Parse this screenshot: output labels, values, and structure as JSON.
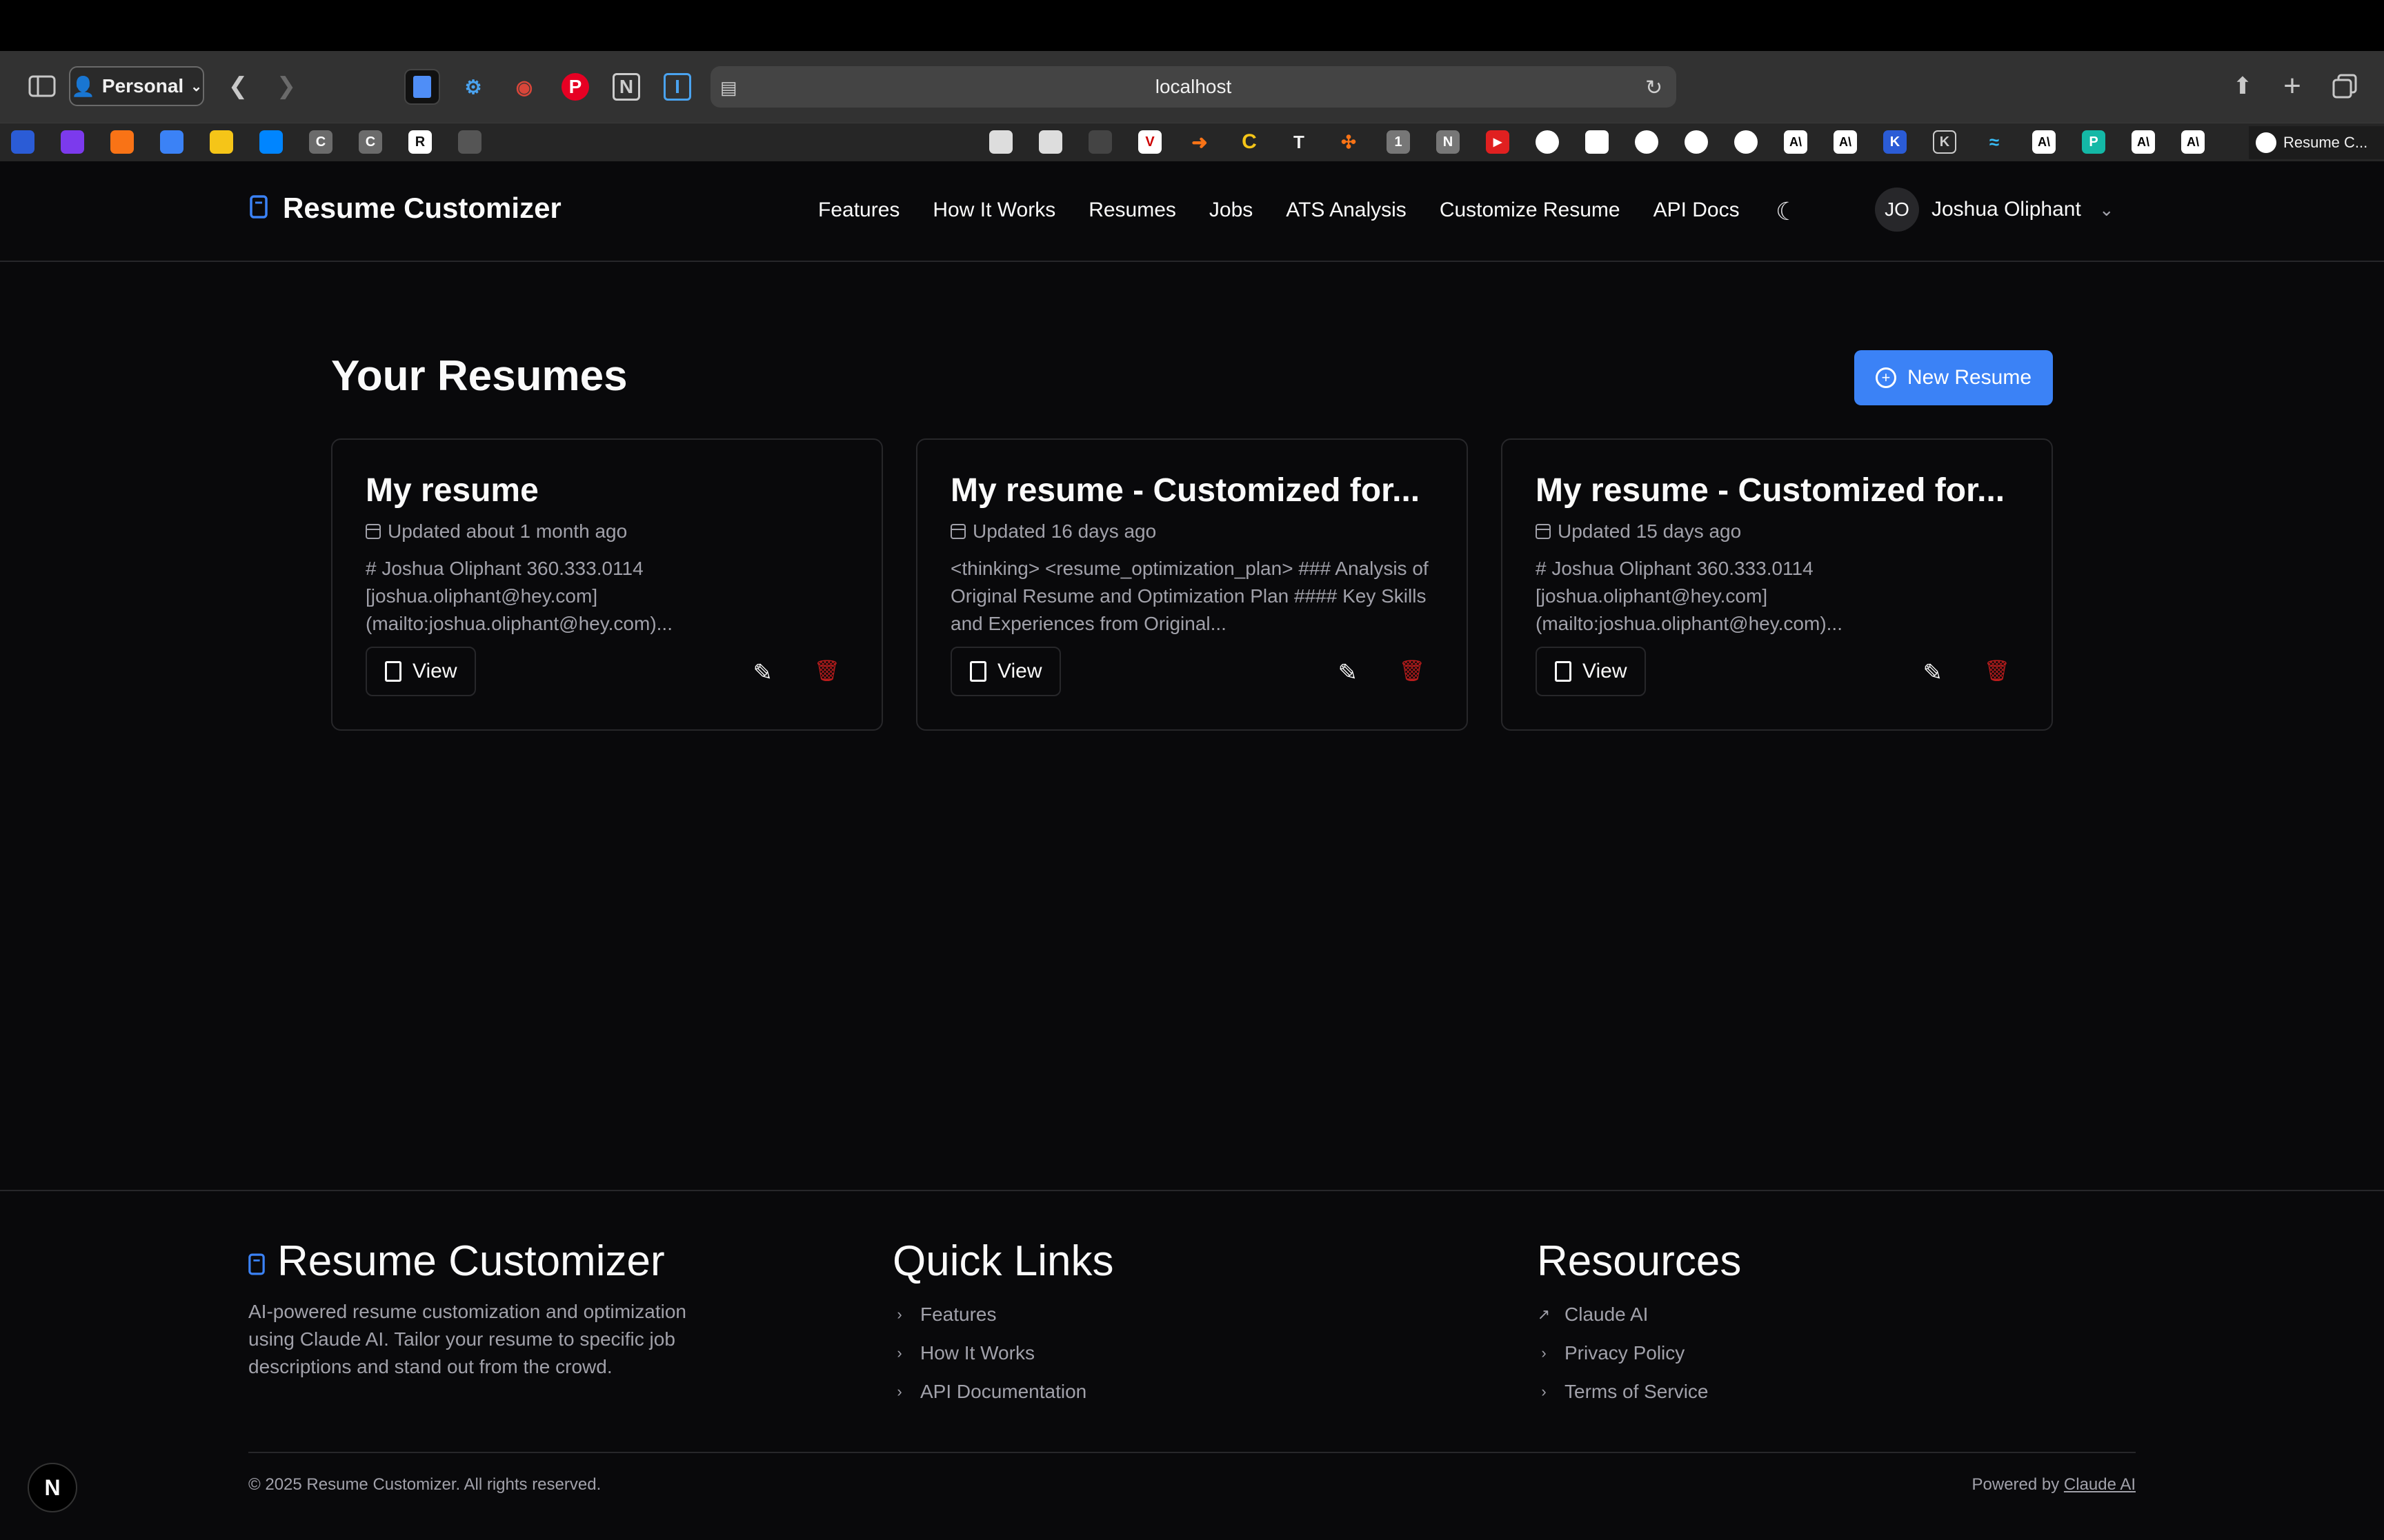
{
  "browser": {
    "profile": "Personal",
    "address": "localhost",
    "active_tab": "Resume C..."
  },
  "favorites": [
    {
      "label": "",
      "color": "#2b5cd6"
    },
    {
      "label": "",
      "color": "#7c3aed"
    },
    {
      "label": "",
      "color": "#f97316"
    },
    {
      "label": "",
      "color": "#3b82f6"
    },
    {
      "label": "",
      "color": "#f5c518"
    },
    {
      "label": "",
      "color": "#0085ff"
    },
    {
      "label": "C",
      "color": "#6b6b6b"
    },
    {
      "label": "C",
      "color": "#6b6b6b"
    },
    {
      "label": "R",
      "color": "#111111"
    },
    {
      "label": "",
      "color": "#555"
    }
  ],
  "nav": {
    "brand": "Resume Customizer",
    "links": [
      "Features",
      "How It Works",
      "Resumes",
      "Jobs",
      "ATS Analysis",
      "Customize Resume",
      "API Docs"
    ],
    "user_initials": "JO",
    "user_name": "Joshua Oliphant"
  },
  "main": {
    "title": "Your Resumes",
    "new_button": "New Resume",
    "cards": [
      {
        "title": "My resume",
        "date": "Updated about 1 month ago",
        "excerpt": "# Joshua Oliphant 360.333.0114 [joshua.oliphant@hey.com] (mailto:joshua.oliphant@hey.com)...",
        "view_label": "View"
      },
      {
        "title": "My resume - Customized for...",
        "date": "Updated 16 days ago",
        "excerpt": "<thinking> <resume_optimization_plan> ### Analysis of Original Resume and Optimization Plan #### Key Skills and Experiences from Original...",
        "view_label": "View"
      },
      {
        "title": "My resume - Customized for...",
        "date": "Updated 15 days ago",
        "excerpt": "# Joshua Oliphant 360.333.0114 [joshua.oliphant@hey.com] (mailto:joshua.oliphant@hey.com)...",
        "view_label": "View"
      }
    ]
  },
  "footer": {
    "brand": "Resume Customizer",
    "description": "AI-powered resume customization and optimization using Claude AI. Tailor your resume to specific job descriptions and stand out from the crowd.",
    "quick_links_title": "Quick Links",
    "quick_links": [
      "Features",
      "How It Works",
      "API Documentation"
    ],
    "resources_title": "Resources",
    "resources": [
      "Claude AI",
      "Privacy Policy",
      "Terms of Service"
    ],
    "copyright": "© 2025 Resume Customizer. All rights reserved.",
    "powered_prefix": "Powered by ",
    "powered_link": "Claude AI"
  },
  "colors": {
    "accent": "#3b82f6",
    "danger": "#b91c1c",
    "background": "#09090b",
    "border": "#27272a"
  }
}
